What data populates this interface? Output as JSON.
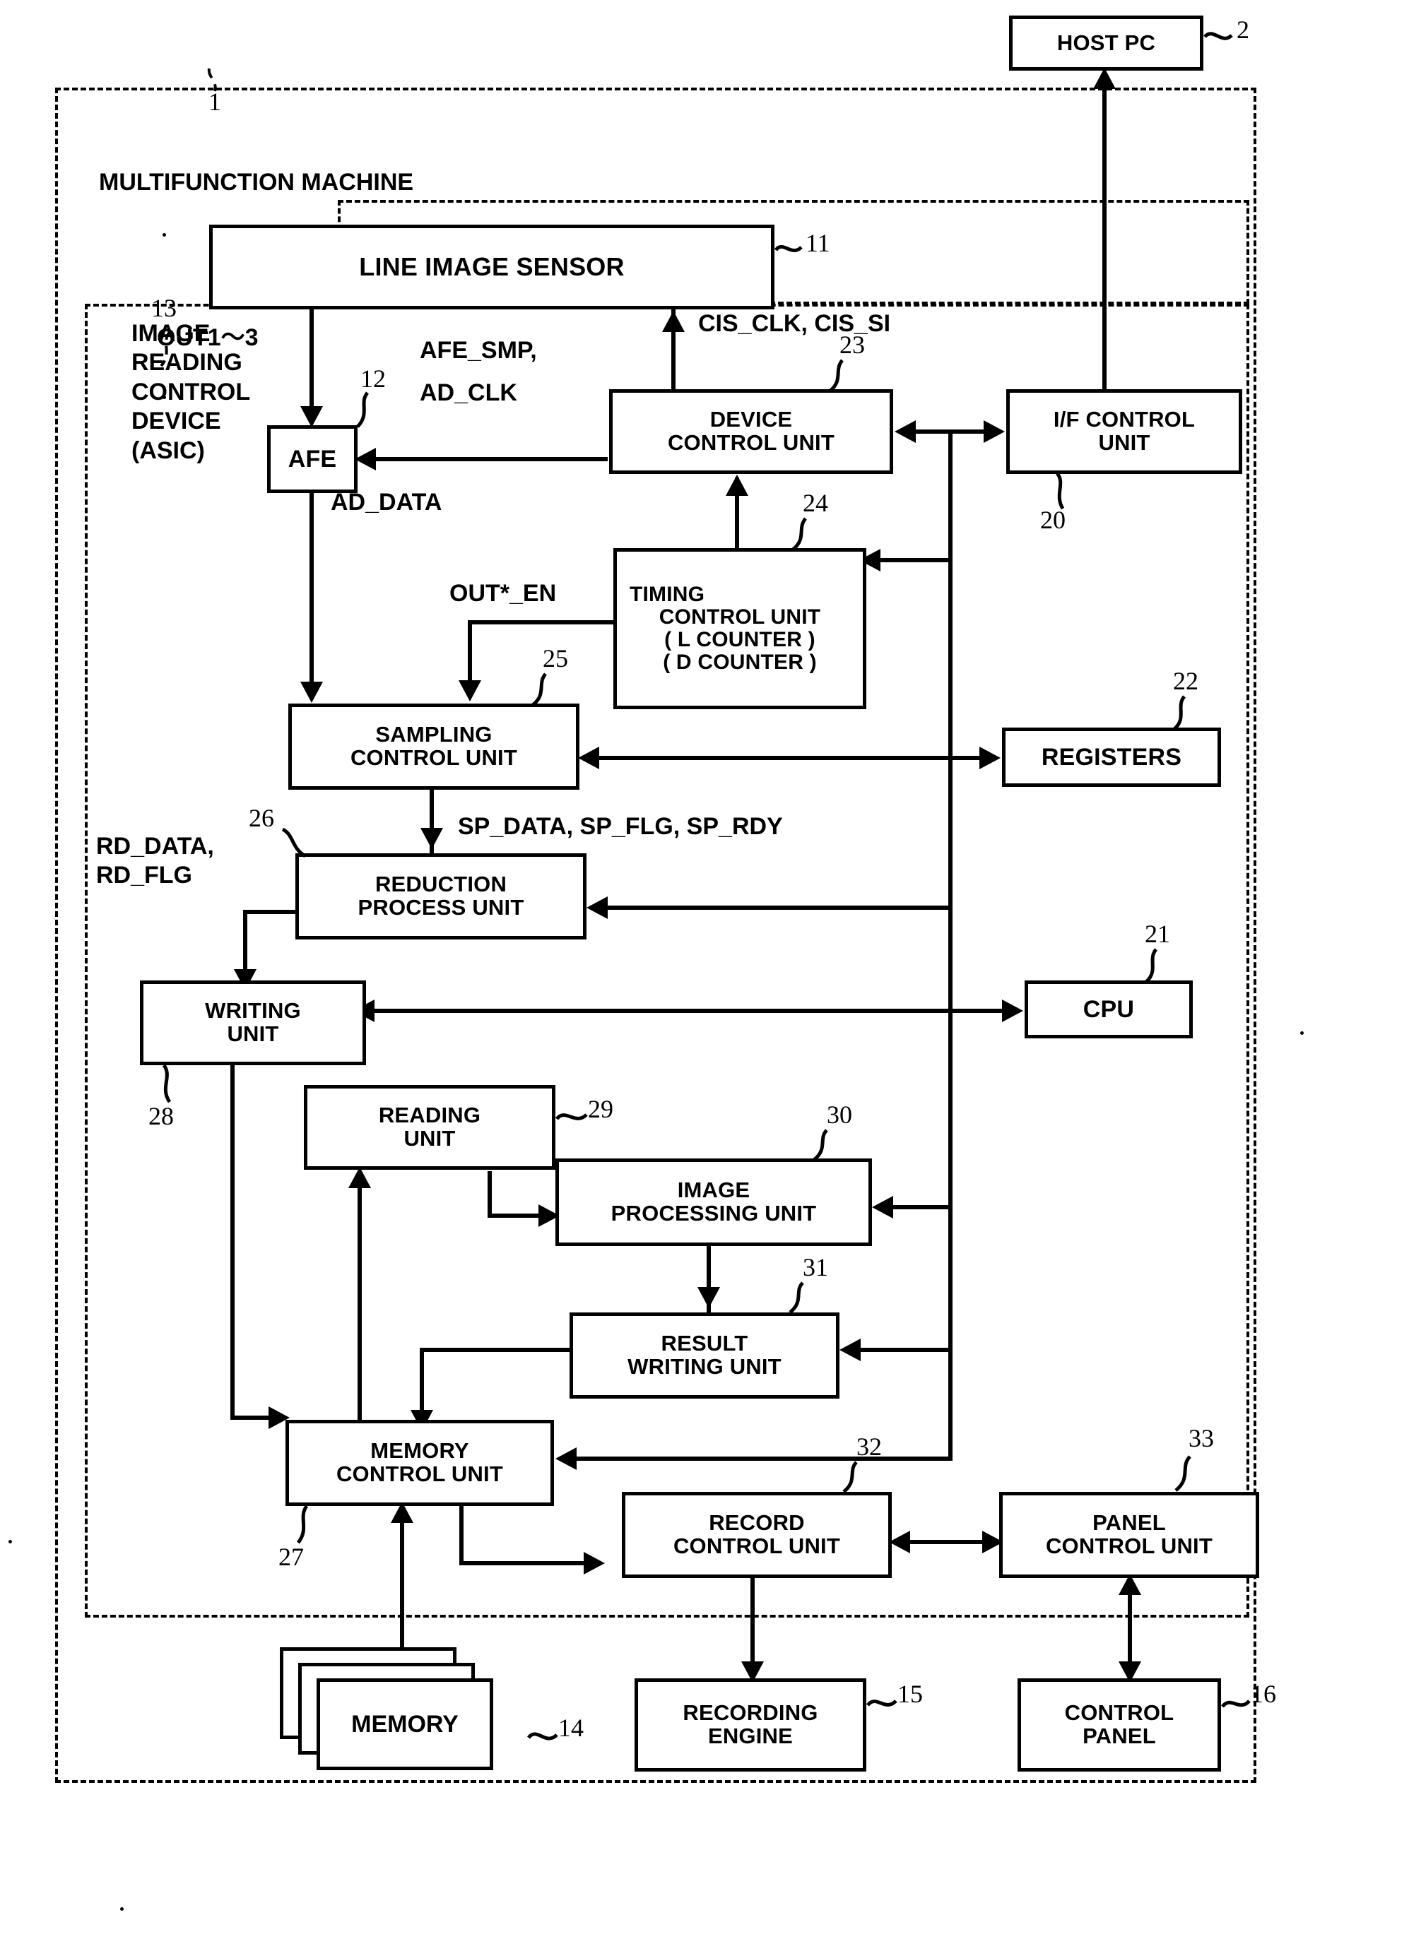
{
  "figure": {
    "outer_label": "MULTIFUNCTION MACHINE",
    "asic_label_lines": [
      "IMAGE",
      "READING",
      "CONTROL",
      "DEVICE",
      "(ASIC)"
    ]
  },
  "blocks": {
    "host_pc": {
      "lines": [
        "HOST PC"
      ],
      "ref": "2"
    },
    "line_image_sensor": {
      "lines": [
        "LINE IMAGE SENSOR"
      ],
      "ref": "11"
    },
    "afe": {
      "lines": [
        "AFE"
      ],
      "ref": "12"
    },
    "device_control": {
      "lines": [
        "DEVICE",
        "CONTROL UNIT"
      ],
      "ref": "23"
    },
    "if_control": {
      "lines": [
        "I/F CONTROL",
        "UNIT"
      ],
      "ref": "20"
    },
    "timing_control": {
      "lines": [
        "TIMING",
        "CONTROL UNIT",
        "( L COUNTER )",
        "( D COUNTER )"
      ],
      "ref": "24"
    },
    "sampling_control": {
      "lines": [
        "SAMPLING",
        "CONTROL UNIT"
      ],
      "ref": "25"
    },
    "registers": {
      "lines": [
        "REGISTERS"
      ],
      "ref": "22"
    },
    "reduction_process": {
      "lines": [
        "REDUCTION",
        "PROCESS UNIT"
      ],
      "ref": "26"
    },
    "cpu": {
      "lines": [
        "CPU"
      ],
      "ref": "21"
    },
    "writing_unit": {
      "lines": [
        "WRITING",
        "UNIT"
      ],
      "ref": "28"
    },
    "reading_unit": {
      "lines": [
        "READING",
        "UNIT"
      ],
      "ref": "29"
    },
    "image_processing": {
      "lines": [
        "IMAGE",
        "PROCESSING UNIT"
      ],
      "ref": "30"
    },
    "result_writing": {
      "lines": [
        "RESULT",
        "WRITING UNIT"
      ],
      "ref": "31"
    },
    "memory_control": {
      "lines": [
        "MEMORY",
        "CONTROL UNIT"
      ],
      "ref": "27"
    },
    "record_control": {
      "lines": [
        "RECORD",
        "CONTROL UNIT"
      ],
      "ref": "32"
    },
    "panel_control": {
      "lines": [
        "PANEL",
        "CONTROL UNIT"
      ],
      "ref": "33"
    },
    "memory": {
      "lines": [
        "MEMORY"
      ],
      "ref": "14"
    },
    "recording_engine": {
      "lines": [
        "RECORDING",
        "ENGINE"
      ],
      "ref": "15"
    },
    "control_panel": {
      "lines": [
        "CONTROL",
        "PANEL"
      ],
      "ref": "16"
    }
  },
  "refs": {
    "multifunction_machine": "1",
    "asic": "13"
  },
  "signals": {
    "out1_3": "OUT1～3",
    "afe_smp": "AFE_SMP,",
    "ad_clk": "AD_CLK",
    "ad_data": "AD_DATA",
    "cis": "CIS_CLK,  CIS_SI",
    "out_en": "OUT*_EN",
    "sp_group": "SP_DATA,  SP_FLG,  SP_RDY",
    "rd_data": "RD_DATA,",
    "rd_flg": "RD_FLG"
  },
  "colors": {
    "ink": "#000000",
    "paper": "#ffffff"
  }
}
